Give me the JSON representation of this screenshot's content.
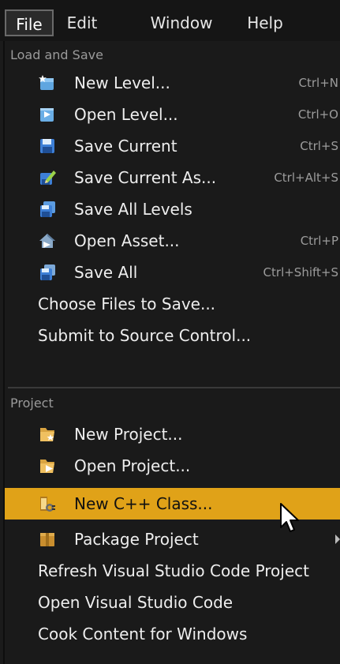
{
  "menubar": {
    "items": [
      {
        "label": "File",
        "active": true
      },
      {
        "label": "Edit",
        "active": false
      },
      {
        "label": "Window",
        "active": false
      },
      {
        "label": "Help",
        "active": false
      }
    ]
  },
  "sections": {
    "load_and_save": {
      "header": "Load and Save",
      "items": [
        {
          "label": "New Level...",
          "shortcut": "Ctrl+N",
          "icon": "new-level-icon"
        },
        {
          "label": "Open Level...",
          "shortcut": "Ctrl+O",
          "icon": "open-level-icon"
        },
        {
          "label": "Save Current",
          "shortcut": "Ctrl+S",
          "icon": "save-current-icon"
        },
        {
          "label": "Save Current As...",
          "shortcut": "Ctrl+Alt+S",
          "icon": "save-as-icon"
        },
        {
          "label": "Save All Levels",
          "shortcut": "",
          "icon": "save-all-levels-icon"
        },
        {
          "label": "Open Asset...",
          "shortcut": "Ctrl+P",
          "icon": "open-asset-icon"
        },
        {
          "label": "Save All",
          "shortcut": "Ctrl+Shift+S",
          "icon": "save-all-icon"
        },
        {
          "label": "Choose Files to Save...",
          "shortcut": ""
        },
        {
          "label": "Submit to Source Control...",
          "shortcut": ""
        }
      ]
    },
    "project": {
      "header": "Project",
      "items": [
        {
          "label": "New Project...",
          "icon": "new-project-icon"
        },
        {
          "label": "Open Project...",
          "icon": "open-project-icon"
        },
        {
          "label": "New C++ Class...",
          "icon": "new-cpp-class-icon",
          "highlighted": true
        },
        {
          "label": "Package Project",
          "icon": "package-project-icon",
          "has_submenu": true
        },
        {
          "label": "Refresh Visual Studio Code Project"
        },
        {
          "label": "Open Visual Studio Code"
        },
        {
          "label": "Cook Content for Windows"
        }
      ]
    }
  },
  "colors": {
    "highlight": "#e0a218",
    "background": "#1a1a1a",
    "text": "#eeeeee",
    "section_header": "#9a9a9a"
  }
}
